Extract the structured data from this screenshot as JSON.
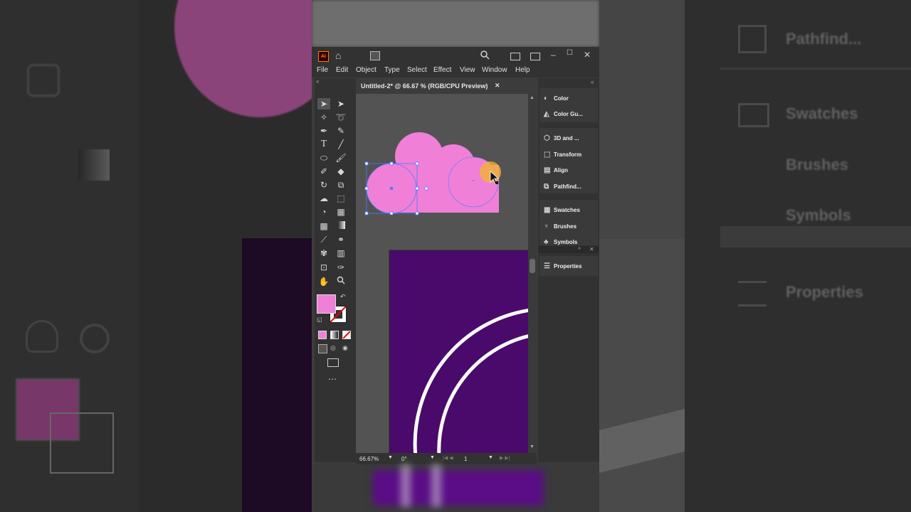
{
  "app": {
    "logo": "Ai",
    "document_tab": "Untitled-2* @ 66.67 % (RGB/CPU Preview)",
    "menus": [
      "File",
      "Edit",
      "Object",
      "Type",
      "Select",
      "Effect",
      "View",
      "Window",
      "Help"
    ]
  },
  "panels": {
    "group1": [
      {
        "label": "Color",
        "icon": "color-icon"
      },
      {
        "label": "Color Gu...",
        "icon": "color-guide-icon"
      }
    ],
    "group2": [
      {
        "label": "3D and ...",
        "icon": "3d-icon"
      },
      {
        "label": "Transform",
        "icon": "transform-icon"
      },
      {
        "label": "Align",
        "icon": "align-icon"
      },
      {
        "label": "Pathfind...",
        "icon": "pathfinder-icon"
      }
    ],
    "group3": [
      {
        "label": "Swatches",
        "icon": "swatches-icon"
      },
      {
        "label": "Brushes",
        "icon": "brushes-icon"
      },
      {
        "label": "Symbols",
        "icon": "symbols-icon"
      }
    ],
    "group4": [
      {
        "label": "Properties",
        "icon": "properties-icon"
      }
    ]
  },
  "status": {
    "zoom": "66.67%",
    "rotation": "0°",
    "artboard": "1"
  },
  "background": {
    "right_labels": [
      "Pathfind...",
      "Swatches",
      "Brushes",
      "Symbols",
      "Properties"
    ]
  },
  "colors": {
    "fill": "#f07fd8",
    "artboard": "#4a0a6b",
    "selection": "#4a7cff",
    "cursor_highlight": "#f2b530"
  }
}
